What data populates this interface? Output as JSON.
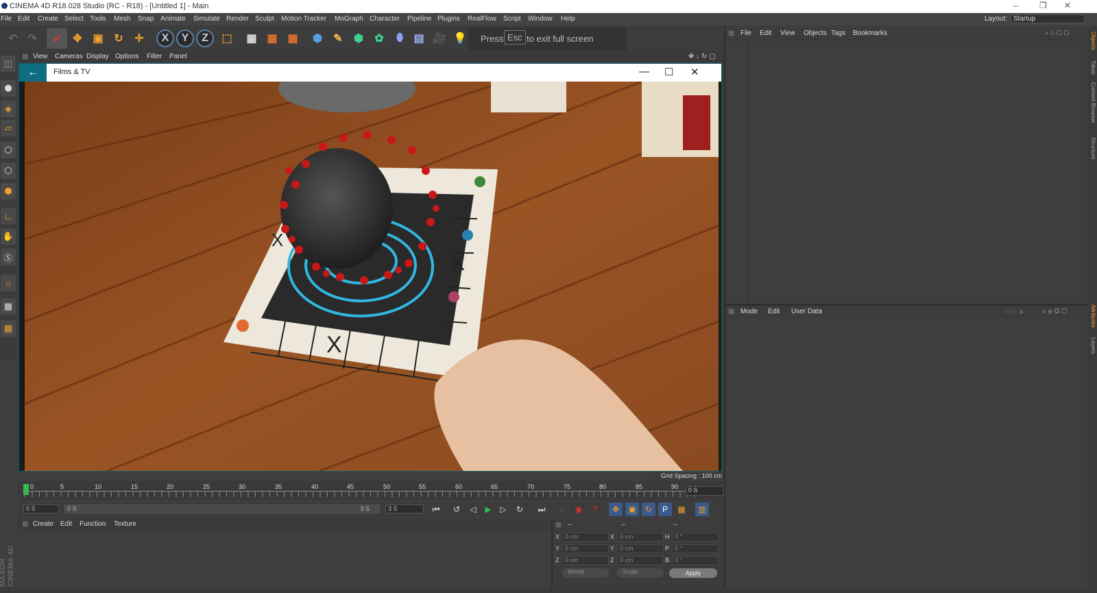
{
  "window": {
    "title": "CINEMA 4D R18.028 Studio (RC - R18) - [Untitled 1] - Main",
    "controls": [
      "–",
      "❐",
      "✕"
    ]
  },
  "menu": {
    "items": [
      "File",
      "Edit",
      "Create",
      "Select",
      "Tools",
      "Mesh",
      "Snap",
      "Animate",
      "Simulate",
      "Render",
      "Sculpt",
      "Motion Tracker",
      "MoGraph",
      "Character",
      "Pipeline",
      "Plugins",
      "RealFlow",
      "Script",
      "Window",
      "Help"
    ],
    "layout_label": "Layout:",
    "layout_value": "Startup"
  },
  "fullscreen_notice": {
    "press": "Press",
    "key": "Esc",
    "rest": "to exit full screen"
  },
  "viewport_menu": [
    "View",
    "Cameras",
    "Display",
    "Options",
    "Filter",
    "Panel"
  ],
  "films_window": {
    "title": "Films & TV",
    "back_icon": "arrow-left-icon",
    "controls": [
      "—",
      "☐",
      "✕"
    ]
  },
  "grid_spacing": "Grid Spacing : 100 cm",
  "timeline": {
    "ticks": [
      "0",
      "5",
      "10",
      "15",
      "20",
      "25",
      "30",
      "35",
      "40",
      "45",
      "50",
      "55",
      "60",
      "65",
      "70",
      "75",
      "80",
      "85",
      "90"
    ],
    "current_frame": "0 S"
  },
  "transport": {
    "start": "0 S",
    "range_start": "0 S",
    "range_end": "3 S",
    "end": "3 S"
  },
  "material_menu": [
    "Create",
    "Edit",
    "Function",
    "Texture"
  ],
  "coords": {
    "header": [
      "--",
      "--",
      "--"
    ],
    "rows": [
      {
        "a": "X",
        "av": "0 cm",
        "b": "X",
        "bv": "0 cm",
        "c": "H",
        "cv": "0 °"
      },
      {
        "a": "Y",
        "av": "0 cm",
        "b": "Y",
        "bv": "0 cm",
        "c": "P",
        "cv": "0 °"
      },
      {
        "a": "Z",
        "av": "0 cm",
        "b": "Z",
        "bv": "0 cm",
        "c": "B",
        "cv": "0 °"
      }
    ],
    "world": "World",
    "scale": "Scale",
    "apply": "Apply"
  },
  "object_menu": [
    "File",
    "Edit",
    "View",
    "Objects",
    "Tags",
    "Bookmarks"
  ],
  "attr_menu": [
    "Mode",
    "Edit",
    "User Data"
  ],
  "side_tabs": [
    "Objects",
    "Takes",
    "Content Browser",
    "Structure",
    "Attributes",
    "Layers"
  ],
  "branding": "MAXON CINEMA 4D"
}
